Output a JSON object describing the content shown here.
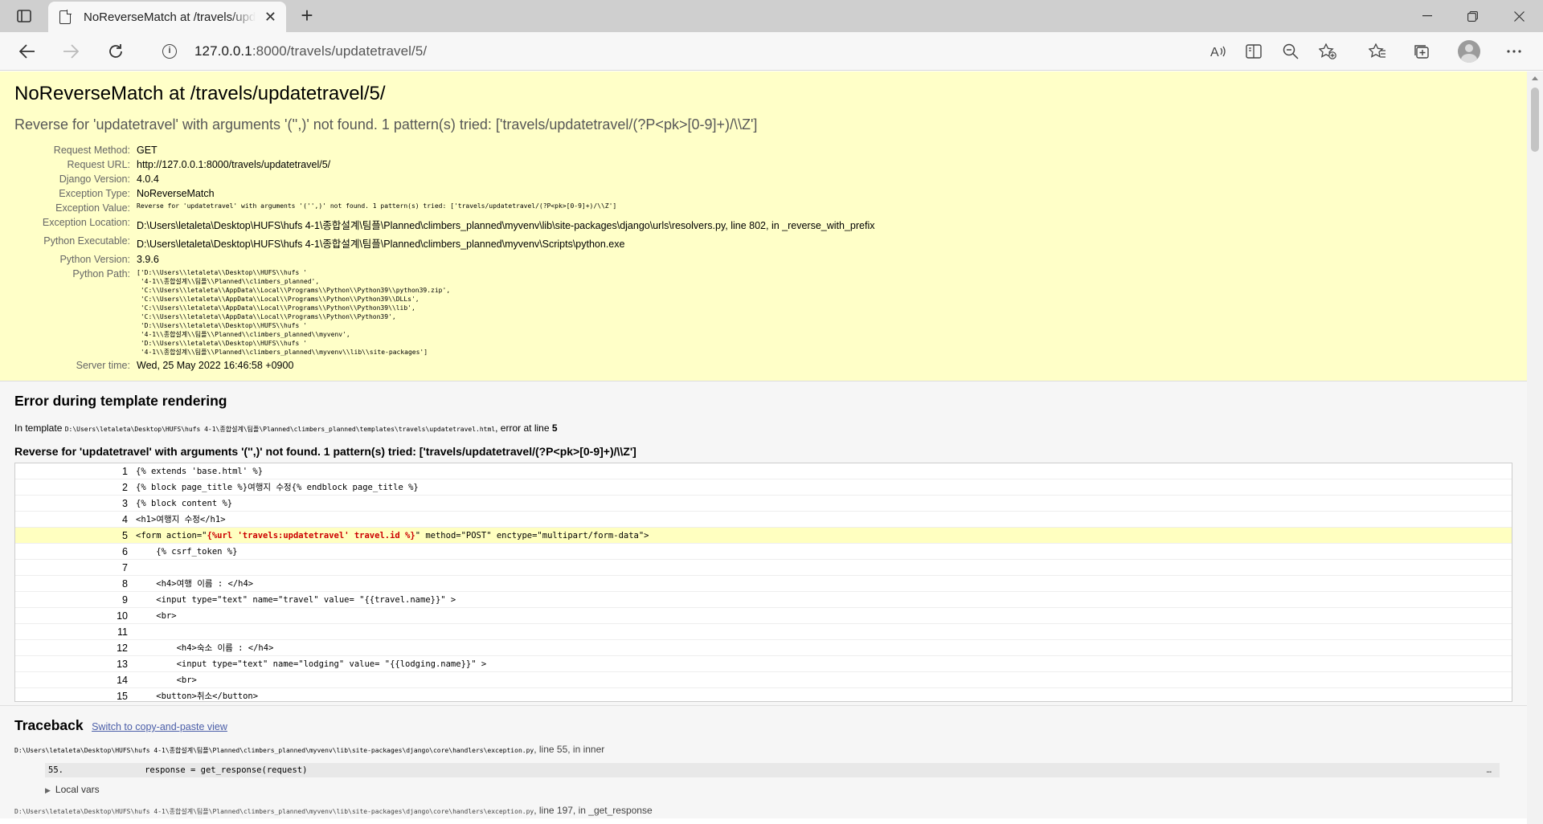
{
  "browser": {
    "tab_title": "NoReverseMatch at /travels/updatetravel/5/",
    "url_host": "127.0.0.1",
    "url_rest": ":8000/travels/updatetravel/5/"
  },
  "summary": {
    "title": "NoReverseMatch at /travels/updatetravel/5/",
    "exception_message": "Reverse for 'updatetravel' with arguments '('',)' not found. 1 pattern(s) tried: ['travels/updatetravel/(?P<pk>[0-9]+)/\\\\Z']",
    "meta": [
      {
        "label": "Request Method:",
        "value": "GET"
      },
      {
        "label": "Request URL:",
        "value": "http://127.0.0.1:8000/travels/updatetravel/5/"
      },
      {
        "label": "Django Version:",
        "value": "4.0.4"
      },
      {
        "label": "Exception Type:",
        "value": "NoReverseMatch"
      },
      {
        "label": "Exception Value:",
        "value": "Reverse for 'updatetravel' with arguments '('',)' not found. 1 pattern(s) tried: ['travels/updatetravel/(?P<pk>[0-9]+)/\\\\Z']"
      },
      {
        "label": "Exception Location:",
        "value": "D:\\Users\\letaleta\\Desktop\\HUFS\\hufs 4-1\\종합설계\\팀플\\Planned\\climbers_planned\\myvenv\\lib\\site-packages\\django\\urls\\resolvers.py, line 802, in _reverse_with_prefix"
      },
      {
        "label": "Python Executable:",
        "value": "D:\\Users\\letaleta\\Desktop\\HUFS\\hufs 4-1\\종합설계\\팀플\\Planned\\climbers_planned\\myvenv\\Scripts\\python.exe"
      },
      {
        "label": "Python Version:",
        "value": "3.9.6"
      },
      {
        "label": "Python Path:",
        "value": "['D:\\\\Users\\\\letaleta\\\\Desktop\\\\HUFS\\\\hufs '\n '4-1\\\\종합설계\\\\팀플\\\\Planned\\\\climbers_planned',\n 'C:\\\\Users\\\\letaleta\\\\AppData\\\\Local\\\\Programs\\\\Python\\\\Python39\\\\python39.zip',\n 'C:\\\\Users\\\\letaleta\\\\AppData\\\\Local\\\\Programs\\\\Python\\\\Python39\\\\DLLs',\n 'C:\\\\Users\\\\letaleta\\\\AppData\\\\Local\\\\Programs\\\\Python\\\\Python39\\\\lib',\n 'C:\\\\Users\\\\letaleta\\\\AppData\\\\Local\\\\Programs\\\\Python\\\\Python39',\n 'D:\\\\Users\\\\letaleta\\\\Desktop\\\\HUFS\\\\hufs '\n '4-1\\\\종합설계\\\\팀플\\\\Planned\\\\climbers_planned\\\\myvenv',\n 'D:\\\\Users\\\\letaleta\\\\Desktop\\\\HUFS\\\\hufs '\n '4-1\\\\종합설계\\\\팀플\\\\Planned\\\\climbers_planned\\\\myvenv\\\\lib\\\\site-packages']"
      },
      {
        "label": "Server time:",
        "value": "Wed, 25 May 2022 16:46:58 +0900"
      }
    ]
  },
  "template_error": {
    "heading": "Error during template rendering",
    "in_template_prefix": "In template ",
    "template_path": "D:\\Users\\letaleta\\Desktop\\HUFS\\hufs 4-1\\종합설계\\팀플\\Planned\\climbers_planned\\templates\\travels\\updatetravel.html",
    "error_at": ", error at line ",
    "error_line": "5",
    "message": "Reverse for 'updatetravel' with arguments '('',)' not found. 1 pattern(s) tried: ['travels/updatetravel/(?P<pk>[0-9]+)/\\\\Z']",
    "source_lines": [
      {
        "n": "1",
        "pre": "{% extends 'base.html' %}",
        "hl": "",
        "post": ""
      },
      {
        "n": "2",
        "pre": "{% block page_title %}여행지 수정{% endblock page_title %}",
        "hl": "",
        "post": ""
      },
      {
        "n": "3",
        "pre": "{% block content %}",
        "hl": "",
        "post": ""
      },
      {
        "n": "4",
        "pre": "<h1>여행지 수정</h1>",
        "hl": "",
        "post": ""
      },
      {
        "n": "5",
        "pre": "<form action=\"",
        "hl": "{%url 'travels:updatetravel' travel.id %}",
        "post": "\" method=\"POST\" enctype=\"multipart/form-data\">"
      },
      {
        "n": "6",
        "pre": "    {% csrf_token %}",
        "hl": "",
        "post": ""
      },
      {
        "n": "7",
        "pre": "",
        "hl": "",
        "post": ""
      },
      {
        "n": "8",
        "pre": "    <h4>여행 이름 : </h4>",
        "hl": "",
        "post": ""
      },
      {
        "n": "9",
        "pre": "    <input type=\"text\" name=\"travel\" value= \"{{travel.name}}\" >",
        "hl": "",
        "post": ""
      },
      {
        "n": "10",
        "pre": "    <br>",
        "hl": "",
        "post": ""
      },
      {
        "n": "11",
        "pre": "",
        "hl": "",
        "post": ""
      },
      {
        "n": "12",
        "pre": "        <h4>숙소 이름 : </h4>",
        "hl": "",
        "post": ""
      },
      {
        "n": "13",
        "pre": "        <input type=\"text\" name=\"lodging\" value= \"{{lodging.name}}\" >",
        "hl": "",
        "post": ""
      },
      {
        "n": "14",
        "pre": "        <br>",
        "hl": "",
        "post": ""
      },
      {
        "n": "15",
        "pre": "    <button>취소</button>",
        "hl": "",
        "post": ""
      }
    ]
  },
  "traceback": {
    "heading": "Traceback",
    "switch_link": "Switch to copy-and-paste view",
    "frame_path": "D:\\Users\\letaleta\\Desktop\\HUFS\\hufs 4-1\\종합설계\\팀플\\Planned\\climbers_planned\\myvenv\\lib\\site-packages\\django\\core\\handlers\\exception.py",
    "frame_suffix": ", line 55, in inner",
    "ctx_lineno": "55.",
    "ctx_code": "                response = get_response(request)",
    "ctx_dots": "…",
    "local_vars": "Local vars",
    "next_suffix": ", line 197, in _get_response"
  }
}
